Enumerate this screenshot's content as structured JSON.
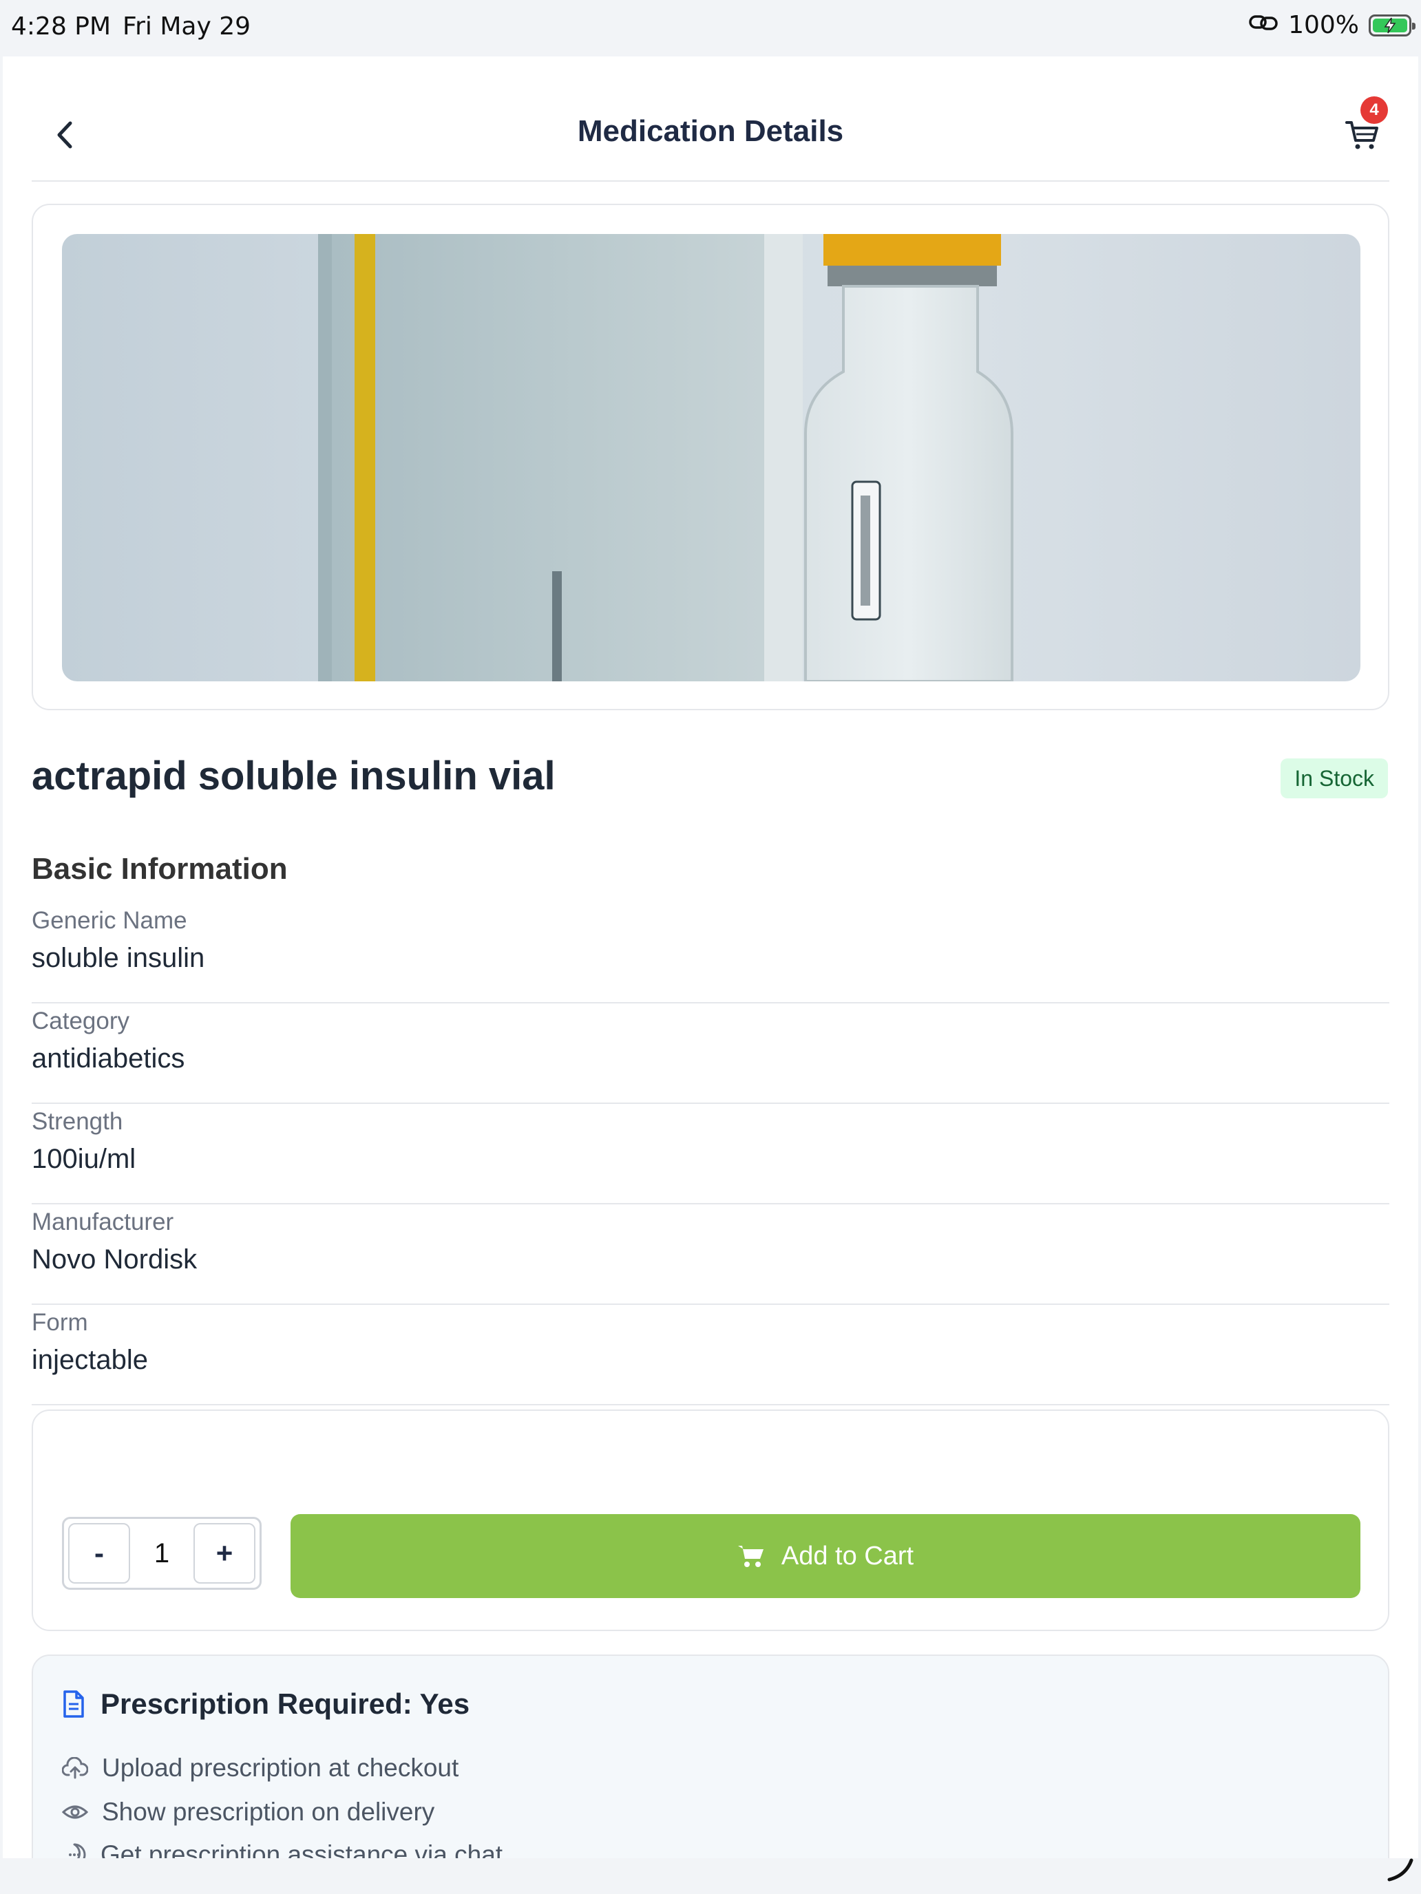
{
  "status_bar": {
    "time": "4:28 PM",
    "date": "Fri May 29",
    "battery": "100%"
  },
  "header": {
    "title": "Medication Details",
    "cart_count": "4"
  },
  "product": {
    "name": "actrapid soluble insulin vial",
    "stock_status": "In Stock",
    "image_icon": "insulin-vial-photo"
  },
  "basic_info": {
    "section_title": "Basic Information",
    "rows": [
      {
        "label": "Generic Name",
        "value": "soluble insulin"
      },
      {
        "label": "Category",
        "value": "antidiabetics"
      },
      {
        "label": "Strength",
        "value": "100iu/ml"
      },
      {
        "label": "Manufacturer",
        "value": "Novo Nordisk"
      },
      {
        "label": "Form",
        "value": "injectable"
      }
    ]
  },
  "cart_controls": {
    "minus_label": "-",
    "quantity": "1",
    "plus_label": "+",
    "add_label": "Add to Cart"
  },
  "prescription": {
    "title": "Prescription Required: Yes",
    "items": [
      {
        "icon": "cloud-upload-icon",
        "text": "Upload prescription at checkout"
      },
      {
        "icon": "eye-icon",
        "text": "Show prescription on delivery"
      },
      {
        "icon": "chat-icon",
        "text": "Get prescription assistance via chat"
      }
    ]
  },
  "colors": {
    "accent_green": "#8bc34a",
    "badge_red": "#e53935",
    "stock_bg": "#dcfce7",
    "stock_text": "#166534",
    "title_navy": "#1f2a44"
  }
}
